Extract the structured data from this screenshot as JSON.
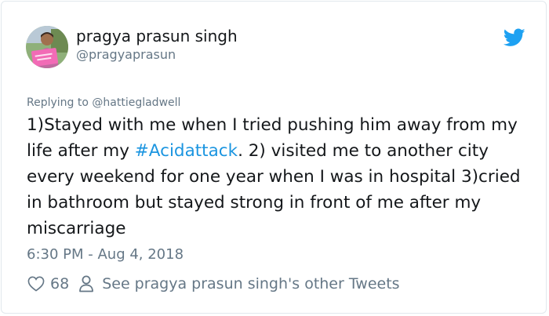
{
  "tweet": {
    "display_name": "pragya prasun singh",
    "handle": "@pragyaprasun",
    "reply_prefix": "Replying to ",
    "reply_to": "@hattiegladwell",
    "text_before_hashtag": "1)Stayed with me when I tried pushing him away from my life after my ",
    "hashtag": "#Acidattack",
    "text_after_hashtag": ". 2) visited me to another city every weekend for one year when I was in hospital 3)cried in bathroom but stayed strong in front of me after my miscarriage",
    "timestamp": "6:30 PM - Aug 4, 2018",
    "like_count": "68",
    "other_tweets_label": "See pragya prasun singh's other Tweets"
  },
  "icons": {
    "brand": "twitter-bird-icon",
    "like": "heart-icon",
    "profile": "person-icon"
  },
  "colors": {
    "twitter_blue": "#1da1f2",
    "hashtag_blue": "#1b95e0",
    "muted_text": "#657786",
    "primary_text": "#14171a"
  }
}
